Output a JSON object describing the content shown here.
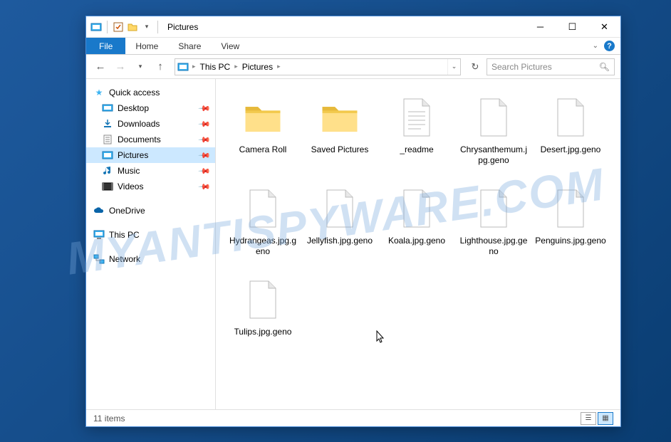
{
  "title": "Pictures",
  "ribbon": {
    "file": "File",
    "home": "Home",
    "share": "Share",
    "view": "View"
  },
  "nav": {
    "breadcrumbs": [
      "This PC",
      "Pictures"
    ],
    "search_placeholder": "Search Pictures"
  },
  "sidebar": {
    "quick_access": "Quick access",
    "qa_items": [
      {
        "label": "Desktop"
      },
      {
        "label": "Downloads"
      },
      {
        "label": "Documents"
      },
      {
        "label": "Pictures",
        "selected": true
      },
      {
        "label": "Music"
      },
      {
        "label": "Videos"
      }
    ],
    "onedrive": "OneDrive",
    "thispc": "This PC",
    "network": "Network"
  },
  "items": [
    {
      "name": "Camera Roll",
      "type": "folder"
    },
    {
      "name": "Saved Pictures",
      "type": "folder"
    },
    {
      "name": "_readme",
      "type": "text"
    },
    {
      "name": "Chrysanthemum.jpg.geno",
      "type": "file"
    },
    {
      "name": "Desert.jpg.geno",
      "type": "file"
    },
    {
      "name": "Hydrangeas.jpg.geno",
      "type": "file"
    },
    {
      "name": "Jellyfish.jpg.geno",
      "type": "file"
    },
    {
      "name": "Koala.jpg.geno",
      "type": "file"
    },
    {
      "name": "Lighthouse.jpg.geno",
      "type": "file"
    },
    {
      "name": "Penguins.jpg.geno",
      "type": "file"
    },
    {
      "name": "Tulips.jpg.geno",
      "type": "file"
    }
  ],
  "status": {
    "count_label": "11 items"
  },
  "watermark": "MYANTISPYWARE.COM"
}
